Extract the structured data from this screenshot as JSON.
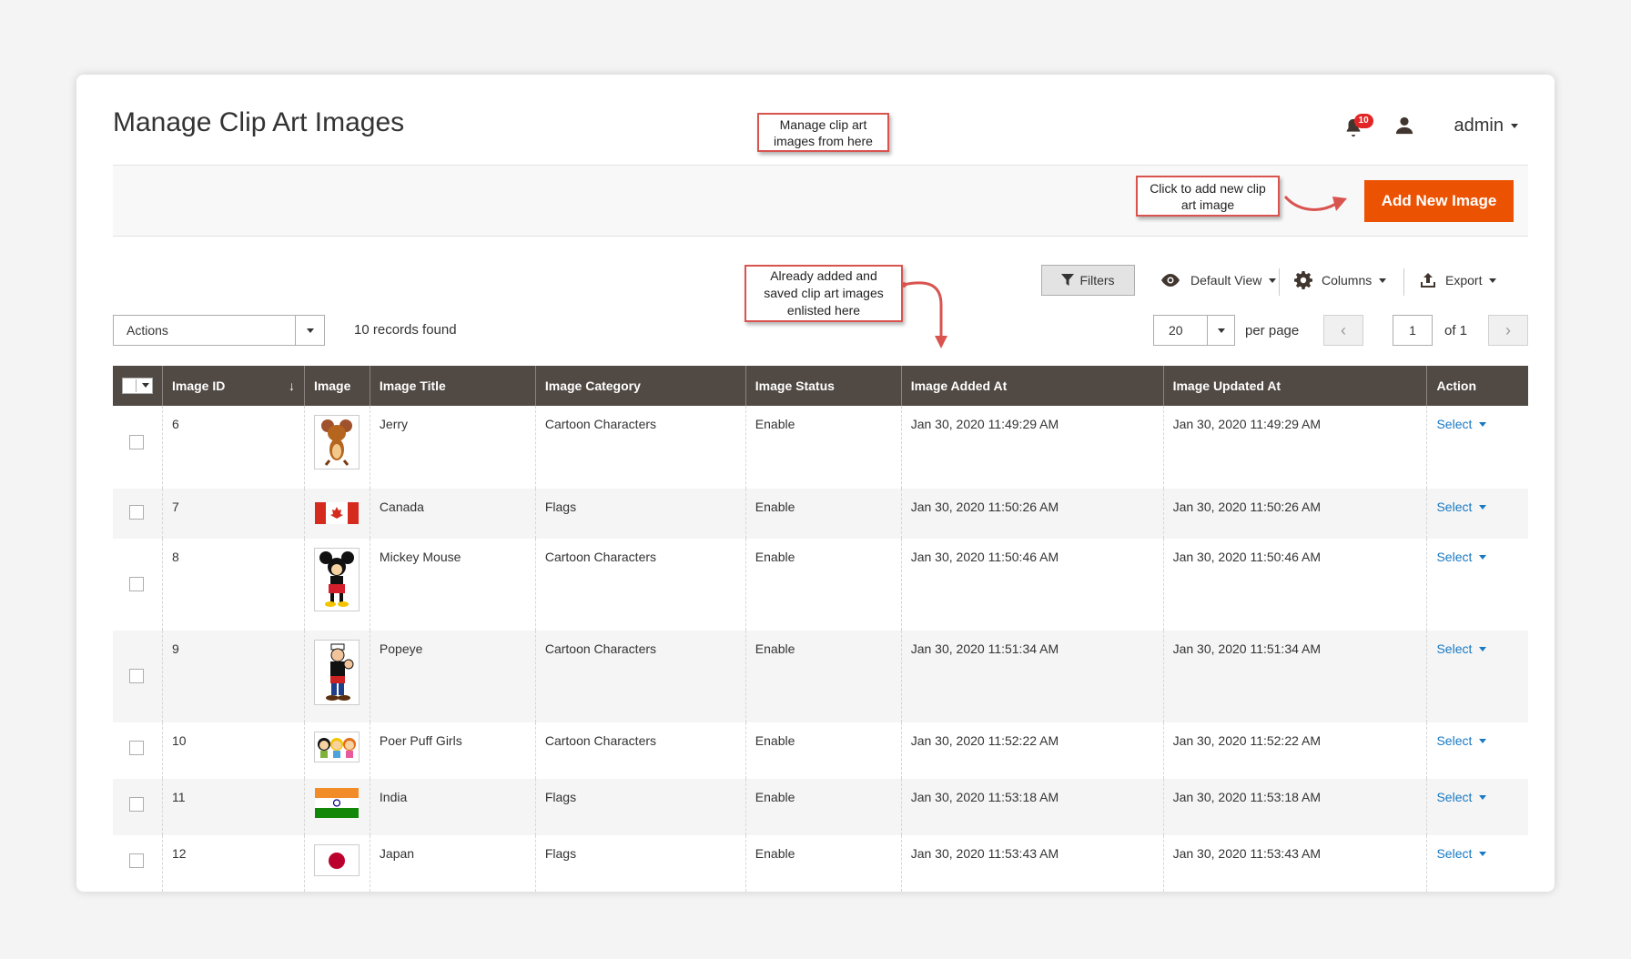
{
  "header": {
    "title": "Manage Clip Art Images",
    "notifications_count": "10",
    "user_name": "admin"
  },
  "callouts": {
    "manage": "Manage clip art images from here",
    "add": "Click to add new clip art image",
    "listed": "Already added and saved clip art images enlisted here"
  },
  "action_bar": {
    "add_button": "Add New Image"
  },
  "toolbar": {
    "filters": "Filters",
    "view": "Default View",
    "columns": "Columns",
    "export": "Export"
  },
  "grid_controls": {
    "actions_label": "Actions",
    "records_found": "10 records found",
    "per_page_value": "20",
    "per_page_label": "per page",
    "current_page": "1",
    "total_pages": "of 1"
  },
  "columns": [
    "Image ID",
    "Image",
    "Image Title",
    "Image Category",
    "Image Status",
    "Image Added At",
    "Image Updated At",
    "Action"
  ],
  "rows": [
    {
      "id": "6",
      "image": "jerry-image",
      "title": "Jerry",
      "category": "Cartoon Characters",
      "status": "Enable",
      "added": "Jan 30, 2020 11:49:29 AM",
      "updated": "Jan 30, 2020 11:49:29 AM",
      "action": "Select"
    },
    {
      "id": "7",
      "image": "canada-flag-image",
      "title": "Canada",
      "category": "Flags",
      "status": "Enable",
      "added": "Jan 30, 2020 11:50:26 AM",
      "updated": "Jan 30, 2020 11:50:26 AM",
      "action": "Select"
    },
    {
      "id": "8",
      "image": "mickey-image",
      "title": "Mickey Mouse",
      "category": "Cartoon Characters",
      "status": "Enable",
      "added": "Jan 30, 2020 11:50:46 AM",
      "updated": "Jan 30, 2020 11:50:46 AM",
      "action": "Select"
    },
    {
      "id": "9",
      "image": "popeye-image",
      "title": "Popeye",
      "category": "Cartoon Characters",
      "status": "Enable",
      "added": "Jan 30, 2020 11:51:34 AM",
      "updated": "Jan 30, 2020 11:51:34 AM",
      "action": "Select"
    },
    {
      "id": "10",
      "image": "powerpuff-image",
      "title": "Poer Puff Girls",
      "category": "Cartoon Characters",
      "status": "Enable",
      "added": "Jan 30, 2020 11:52:22 AM",
      "updated": "Jan 30, 2020 11:52:22 AM",
      "action": "Select"
    },
    {
      "id": "11",
      "image": "india-flag-image",
      "title": "India",
      "category": "Flags",
      "status": "Enable",
      "added": "Jan 30, 2020 11:53:18 AM",
      "updated": "Jan 30, 2020 11:53:18 AM",
      "action": "Select"
    },
    {
      "id": "12",
      "image": "japan-flag-image",
      "title": "Japan",
      "category": "Flags",
      "status": "Enable",
      "added": "Jan 30, 2020 11:53:43 AM",
      "updated": "Jan 30, 2020 11:53:43 AM",
      "action": "Select"
    }
  ],
  "colors": {
    "accent": "#eb5202",
    "header_bg": "#514943",
    "link": "#1979c3",
    "callout_border": "#d9534f"
  }
}
